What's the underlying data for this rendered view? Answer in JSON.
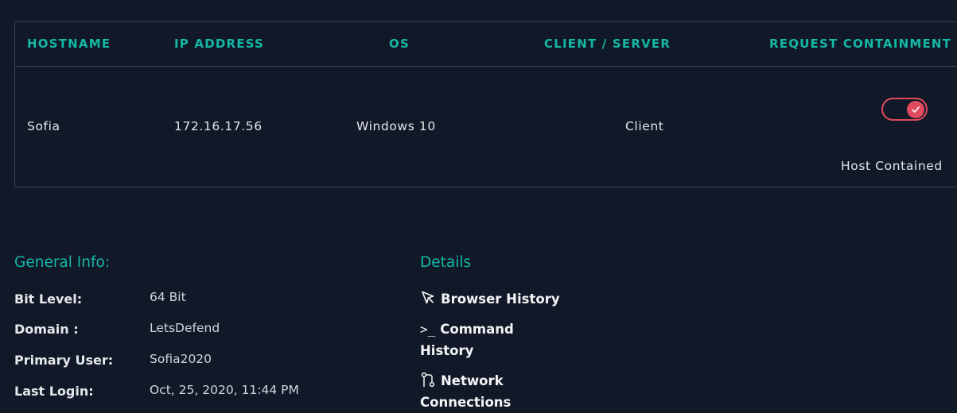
{
  "table": {
    "headers": {
      "hostname": "HOSTNAME",
      "ip": "IP ADDRESS",
      "os": "OS",
      "client_server": "CLIENT / SERVER",
      "containment": "REQUEST CONTAINMENT"
    },
    "row": {
      "hostname": "Sofia",
      "ip": "172.16.17.56",
      "os": "Windows 10",
      "client_server": "Client",
      "containment_on": true,
      "containment_status": "Host Contained"
    }
  },
  "general_info": {
    "title": "General Info:",
    "items": [
      {
        "label": "Bit Level:",
        "value": "64 Bit"
      },
      {
        "label": "Domain :",
        "value": "LetsDefend"
      },
      {
        "label": "Primary User:",
        "value": "Sofia2020"
      },
      {
        "label": "Last Login:",
        "value": "Oct, 25, 2020, 11:44 PM"
      }
    ]
  },
  "details": {
    "title": "Details",
    "links": [
      {
        "label": "Browser History",
        "icon": "cursor-arrow-icon"
      },
      {
        "label": "Command History",
        "icon": "terminal-icon"
      },
      {
        "label": "Network Connections",
        "icon": "git-branch-icon"
      }
    ]
  },
  "colors": {
    "background": "#111827",
    "accent": "#14b8a6",
    "toggle": "#e04b5e",
    "border": "#374151"
  }
}
